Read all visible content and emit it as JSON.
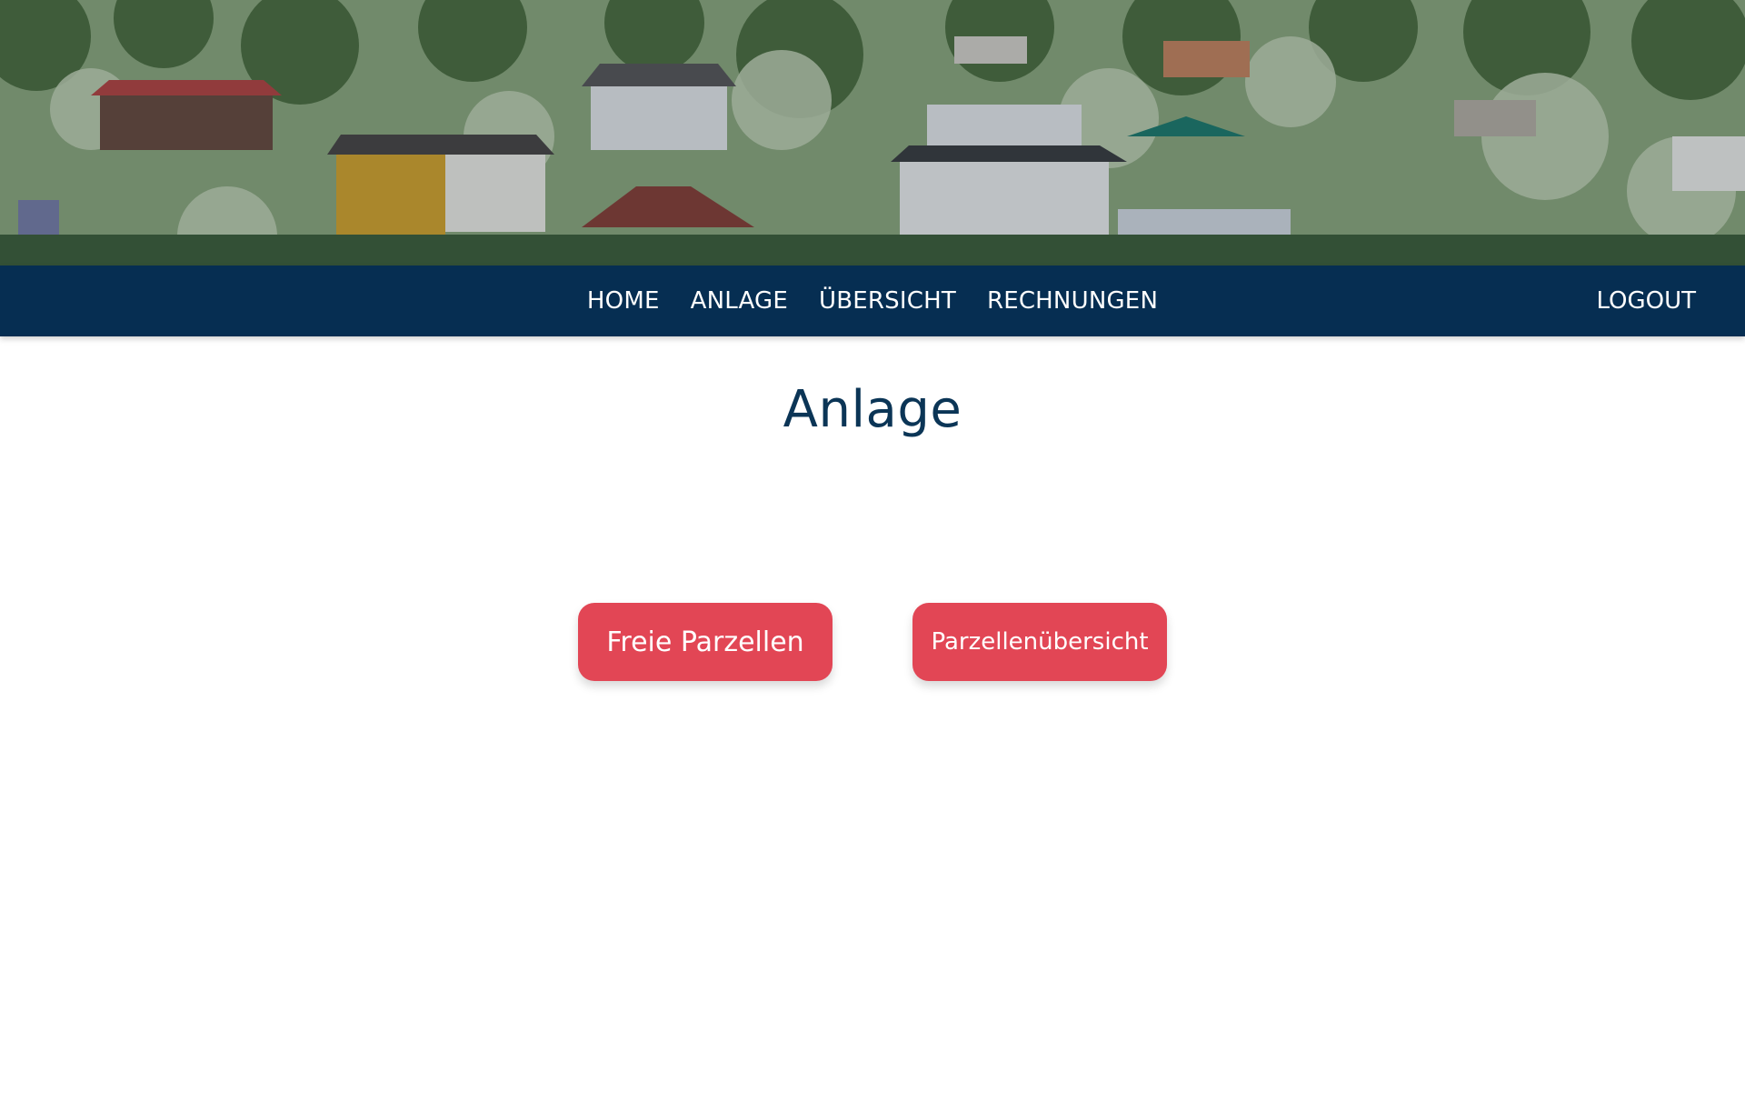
{
  "hero": {
    "image": "garden-allotment-houses-illustration"
  },
  "nav": {
    "items": [
      {
        "label": "HOME"
      },
      {
        "label": "ANLAGE"
      },
      {
        "label": "ÜBERSICHT"
      },
      {
        "label": "RECHNUNGEN"
      }
    ],
    "logout_label": "LOGOUT"
  },
  "main": {
    "title": "Anlage",
    "buttons": {
      "free_plots": "Freie Parzellen",
      "plot_overview": "Parzellenübersicht"
    }
  },
  "colors": {
    "navbar": "#062e52",
    "title": "#0b3556",
    "button": "#e24655"
  }
}
